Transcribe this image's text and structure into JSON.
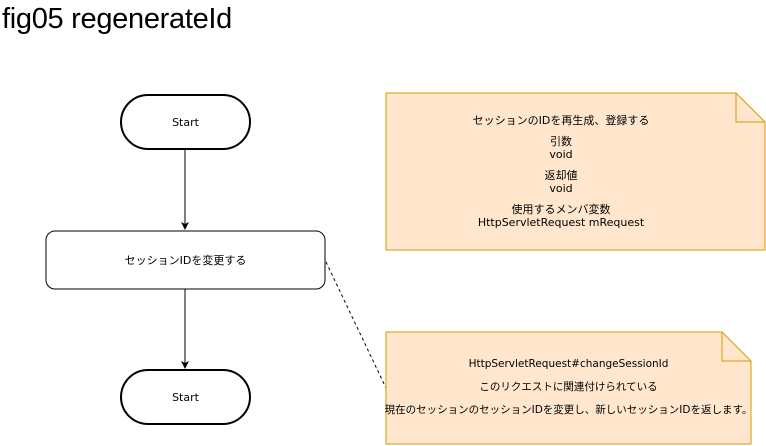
{
  "title": "fig05 regenerateId",
  "colors": {
    "note_fill": "#ffe6cc",
    "note_stroke": "#d79b00",
    "shape_stroke": "#000000"
  },
  "flow": {
    "start_top": "Start",
    "process": "セッションIDを変更する",
    "start_bottom": "Start"
  },
  "note_main": {
    "heading": "セッションのIDを再生成、登録する",
    "args_label": "引数",
    "args_value": "void",
    "return_label": "返却値",
    "return_value": "void",
    "members_label": "使用するメンバ変数",
    "members_value": "HttpServletRequest mRequest"
  },
  "note_detail": {
    "line1": "HttpServletRequest#changeSessionId",
    "line2": "このリクエストに関連付けられている",
    "line3": "現在のセッションのセッションIDを変更し、新しいセッションIDを返します。"
  }
}
